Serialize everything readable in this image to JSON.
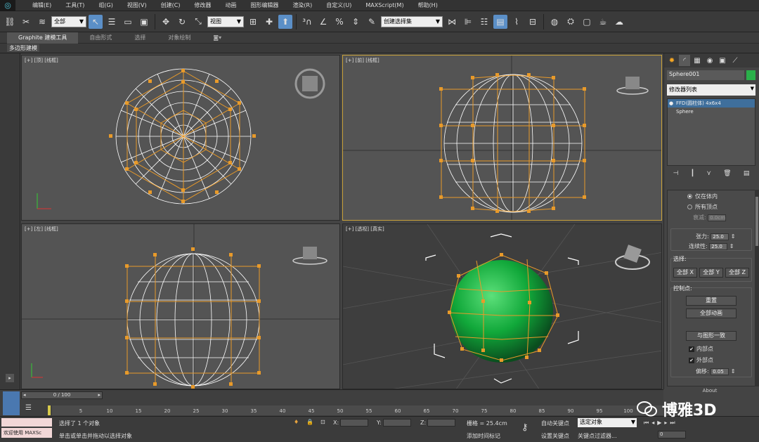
{
  "menu": [
    "编辑(E)",
    "工具(T)",
    "组(G)",
    "视图(V)",
    "创建(C)",
    "修改器",
    "动画",
    "图形编辑器",
    "渲染(R)",
    "自定义(U)",
    "MAXScript(M)",
    "帮助(H)"
  ],
  "toolbar": {
    "filter_select": "全部",
    "coord_select": "视图",
    "named_selection": "创建选择集"
  },
  "ribbon": {
    "tabs": [
      "Graphite 建模工具",
      "自由形式",
      "选择",
      "对象绘制"
    ],
    "sub_label": "多边形建模"
  },
  "viewports": {
    "top": "[+] [顶] [线框]",
    "front": "[+] [前] [线框]",
    "left": "[+] [左] [线框]",
    "perspective": "[+] [透视] [真实]"
  },
  "command_panel": {
    "object_name": "Sphere001",
    "object_color": "#2ab04a",
    "modifier_list": "修改器列表",
    "stack": [
      "FFD(圆柱体) 4x6x4",
      "Sphere"
    ],
    "params": {
      "inside_only": "仅在体内",
      "all_vertices": "所有顶点",
      "falloff_label": "衰减:",
      "falloff_value": "0.0cm",
      "tension_label": "张力:",
      "tension_value": "25.0",
      "continuity_label": "连续性:",
      "continuity_value": "25.0",
      "selection_group": "选择:",
      "all_x": "全部 X",
      "all_y": "全部 Y",
      "all_z": "全部 Z",
      "control_points_group": "控制点:",
      "reset": "重置",
      "animate_all": "全部动画",
      "conform_to_shape": "与图形一致",
      "inside_points": "内部点",
      "outside_points": "外部点",
      "offset_label": "偏移:",
      "offset_value": "0.05",
      "about": "About"
    }
  },
  "timeline": {
    "slider": "0 / 100",
    "ticks": [
      "5",
      "10",
      "15",
      "20",
      "25",
      "30",
      "35",
      "40",
      "45",
      "50",
      "55",
      "60",
      "65",
      "70",
      "75",
      "80",
      "85",
      "90",
      "95",
      "100"
    ]
  },
  "status": {
    "welcome": "欢迎使用 MAXSc",
    "selected": "选择了 1 个对象",
    "prompt": "单击或单击并拖动以选择对象",
    "x_label": "X:",
    "y_label": "Y:",
    "z_label": "Z:",
    "grid": "栅格 = 25.4cm",
    "add_time_tag": "添加时间标记",
    "auto_key": "自动关键点",
    "set_key": "设置关键点",
    "selection_mode": "选定对象",
    "key_filters": "关键点过滤器...",
    "frame": "0"
  },
  "watermark": "博雅3D"
}
